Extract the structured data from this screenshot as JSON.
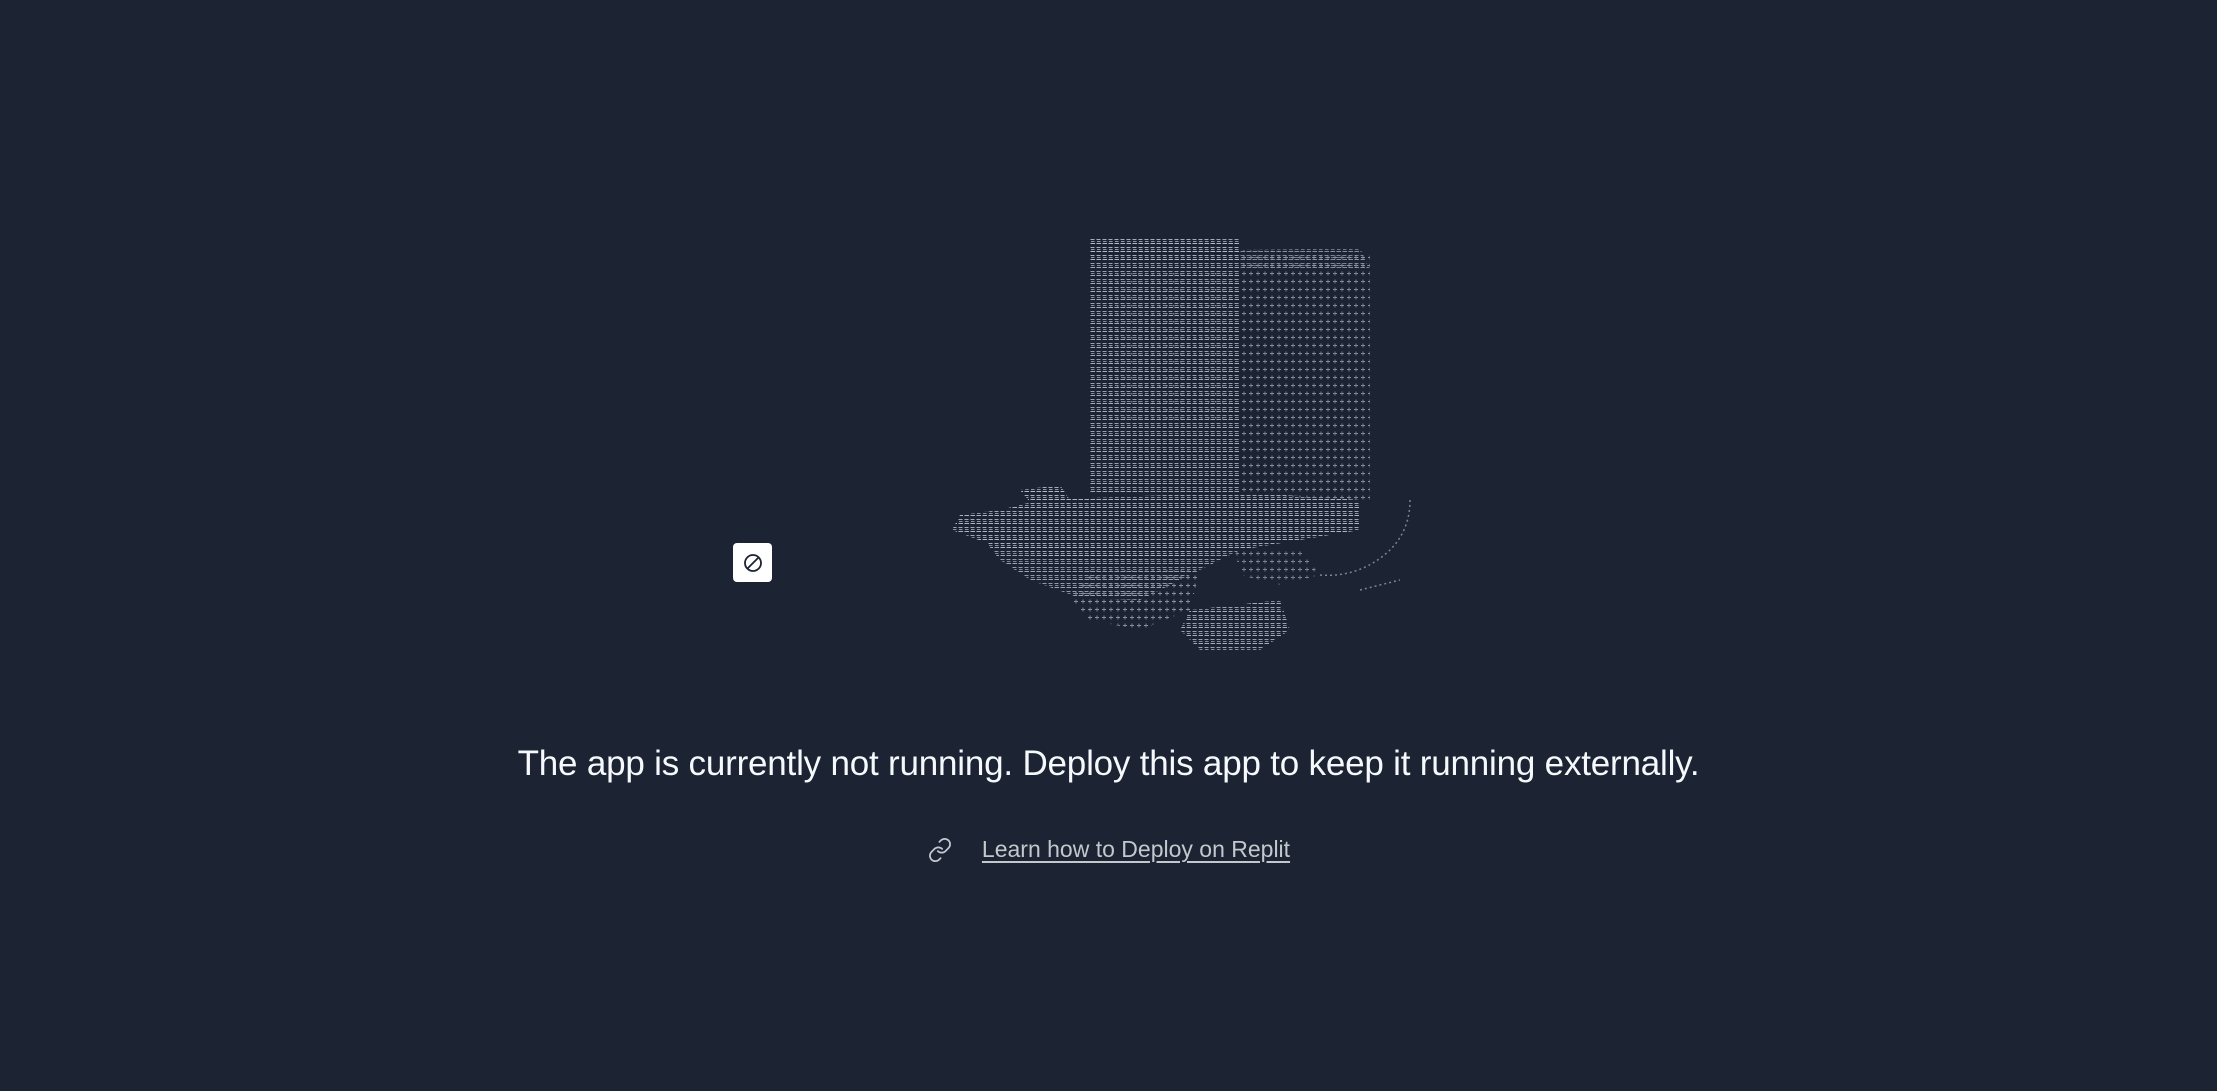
{
  "status": {
    "message": "The app is currently not running. Deploy this app to keep it running externally."
  },
  "learn": {
    "link_label": "Learn how to Deploy on Replit"
  },
  "icons": {
    "stop": "prohibited-icon",
    "link": "link-icon",
    "illustration": "ascii-art-boot-illustration"
  },
  "colors": {
    "background": "#1c2333",
    "text": "#f5f9fc",
    "link": "#c2c8cc",
    "ascii": "#9aa3b0"
  }
}
